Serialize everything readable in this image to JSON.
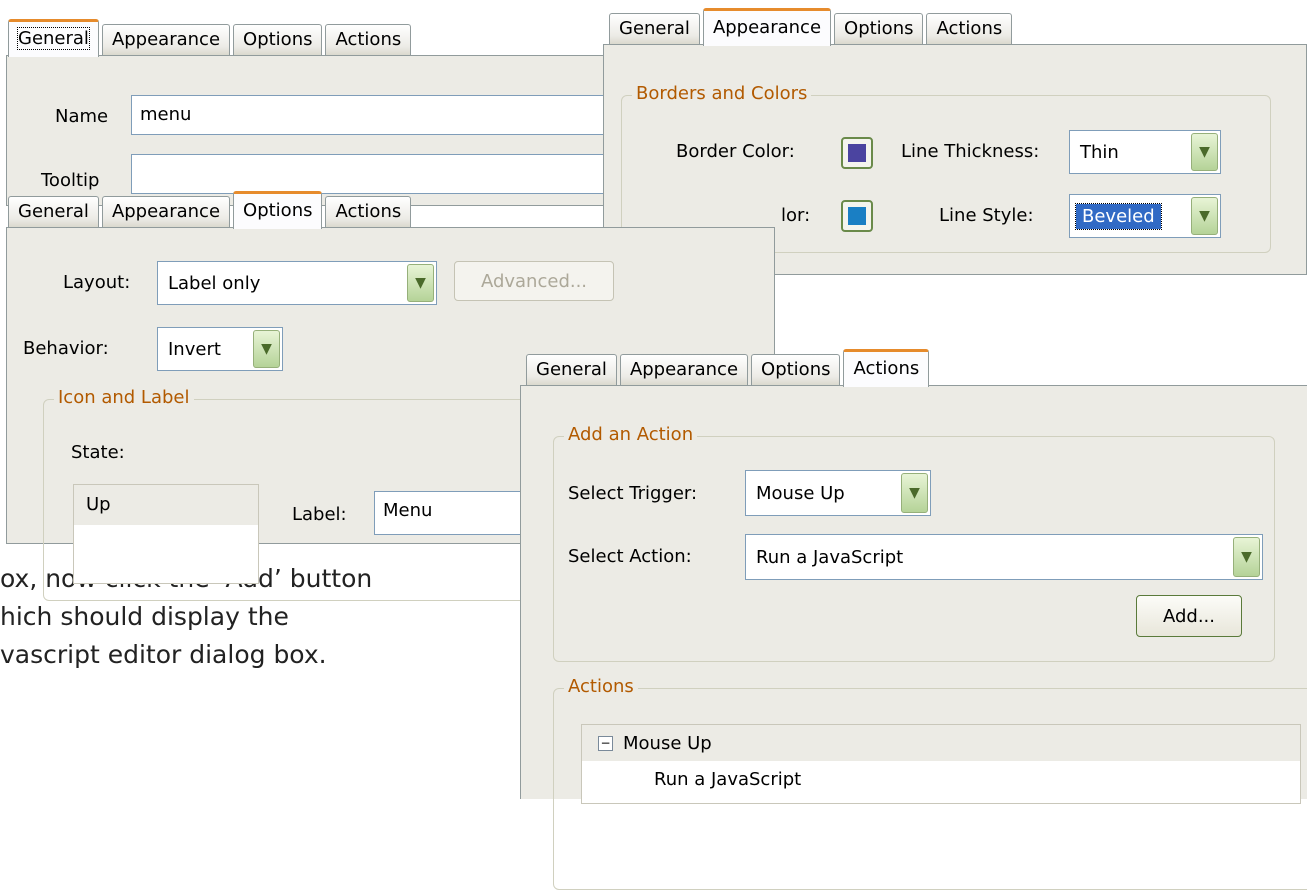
{
  "caption": {
    "lines": [
      "ox, now click the ‘Add’ button",
      "hich should display the",
      "vascript editor dialog box."
    ]
  },
  "general_panel": {
    "tabs": [
      "General",
      "Appearance",
      "Options",
      "Actions"
    ],
    "active_tab": "General",
    "name_label": "Name",
    "name_value": "menu",
    "tooltip_label": "Tooltip",
    "tooltip_value": ""
  },
  "appearance_panel": {
    "tabs": [
      "General",
      "Appearance",
      "Options",
      "Actions"
    ],
    "active_tab": "Appearance",
    "group_label": "Borders and Colors",
    "border_color_label": "Border Color:",
    "border_color": "#4b44a0",
    "line_thickness_label": "Line Thickness:",
    "line_thickness_value": "Thin",
    "fill_color_label_partial": "lor:",
    "fill_color": "#1a7fc4",
    "line_style_label": "Line Style:",
    "line_style_value": "Beveled"
  },
  "options_panel": {
    "tabs": [
      "General",
      "Appearance",
      "Options",
      "Actions"
    ],
    "active_tab": "Options",
    "layout_label": "Layout:",
    "layout_value": "Label only",
    "advanced_button": "Advanced...",
    "behavior_label": "Behavior:",
    "behavior_value": "Invert",
    "group_label": "Icon and Label",
    "state_label": "State:",
    "state_items": [
      "Up"
    ],
    "label_label": "Label:",
    "label_value": "Menu"
  },
  "actions_panel": {
    "tabs": [
      "General",
      "Appearance",
      "Options",
      "Actions"
    ],
    "active_tab": "Actions",
    "add_group_label": "Add an Action",
    "trigger_label": "Select Trigger:",
    "trigger_value": "Mouse Up",
    "action_label": "Select Action:",
    "action_value": "Run a JavaScript",
    "add_button": "Add...",
    "actions_group_label": "Actions",
    "tree": {
      "node": "Mouse Up",
      "expander": "−",
      "children": [
        "Run a JavaScript"
      ]
    }
  },
  "colors": {
    "accent_tab": "#e68b2c",
    "group_label": "#b25a00",
    "panel_bg": "#ecebe5"
  }
}
